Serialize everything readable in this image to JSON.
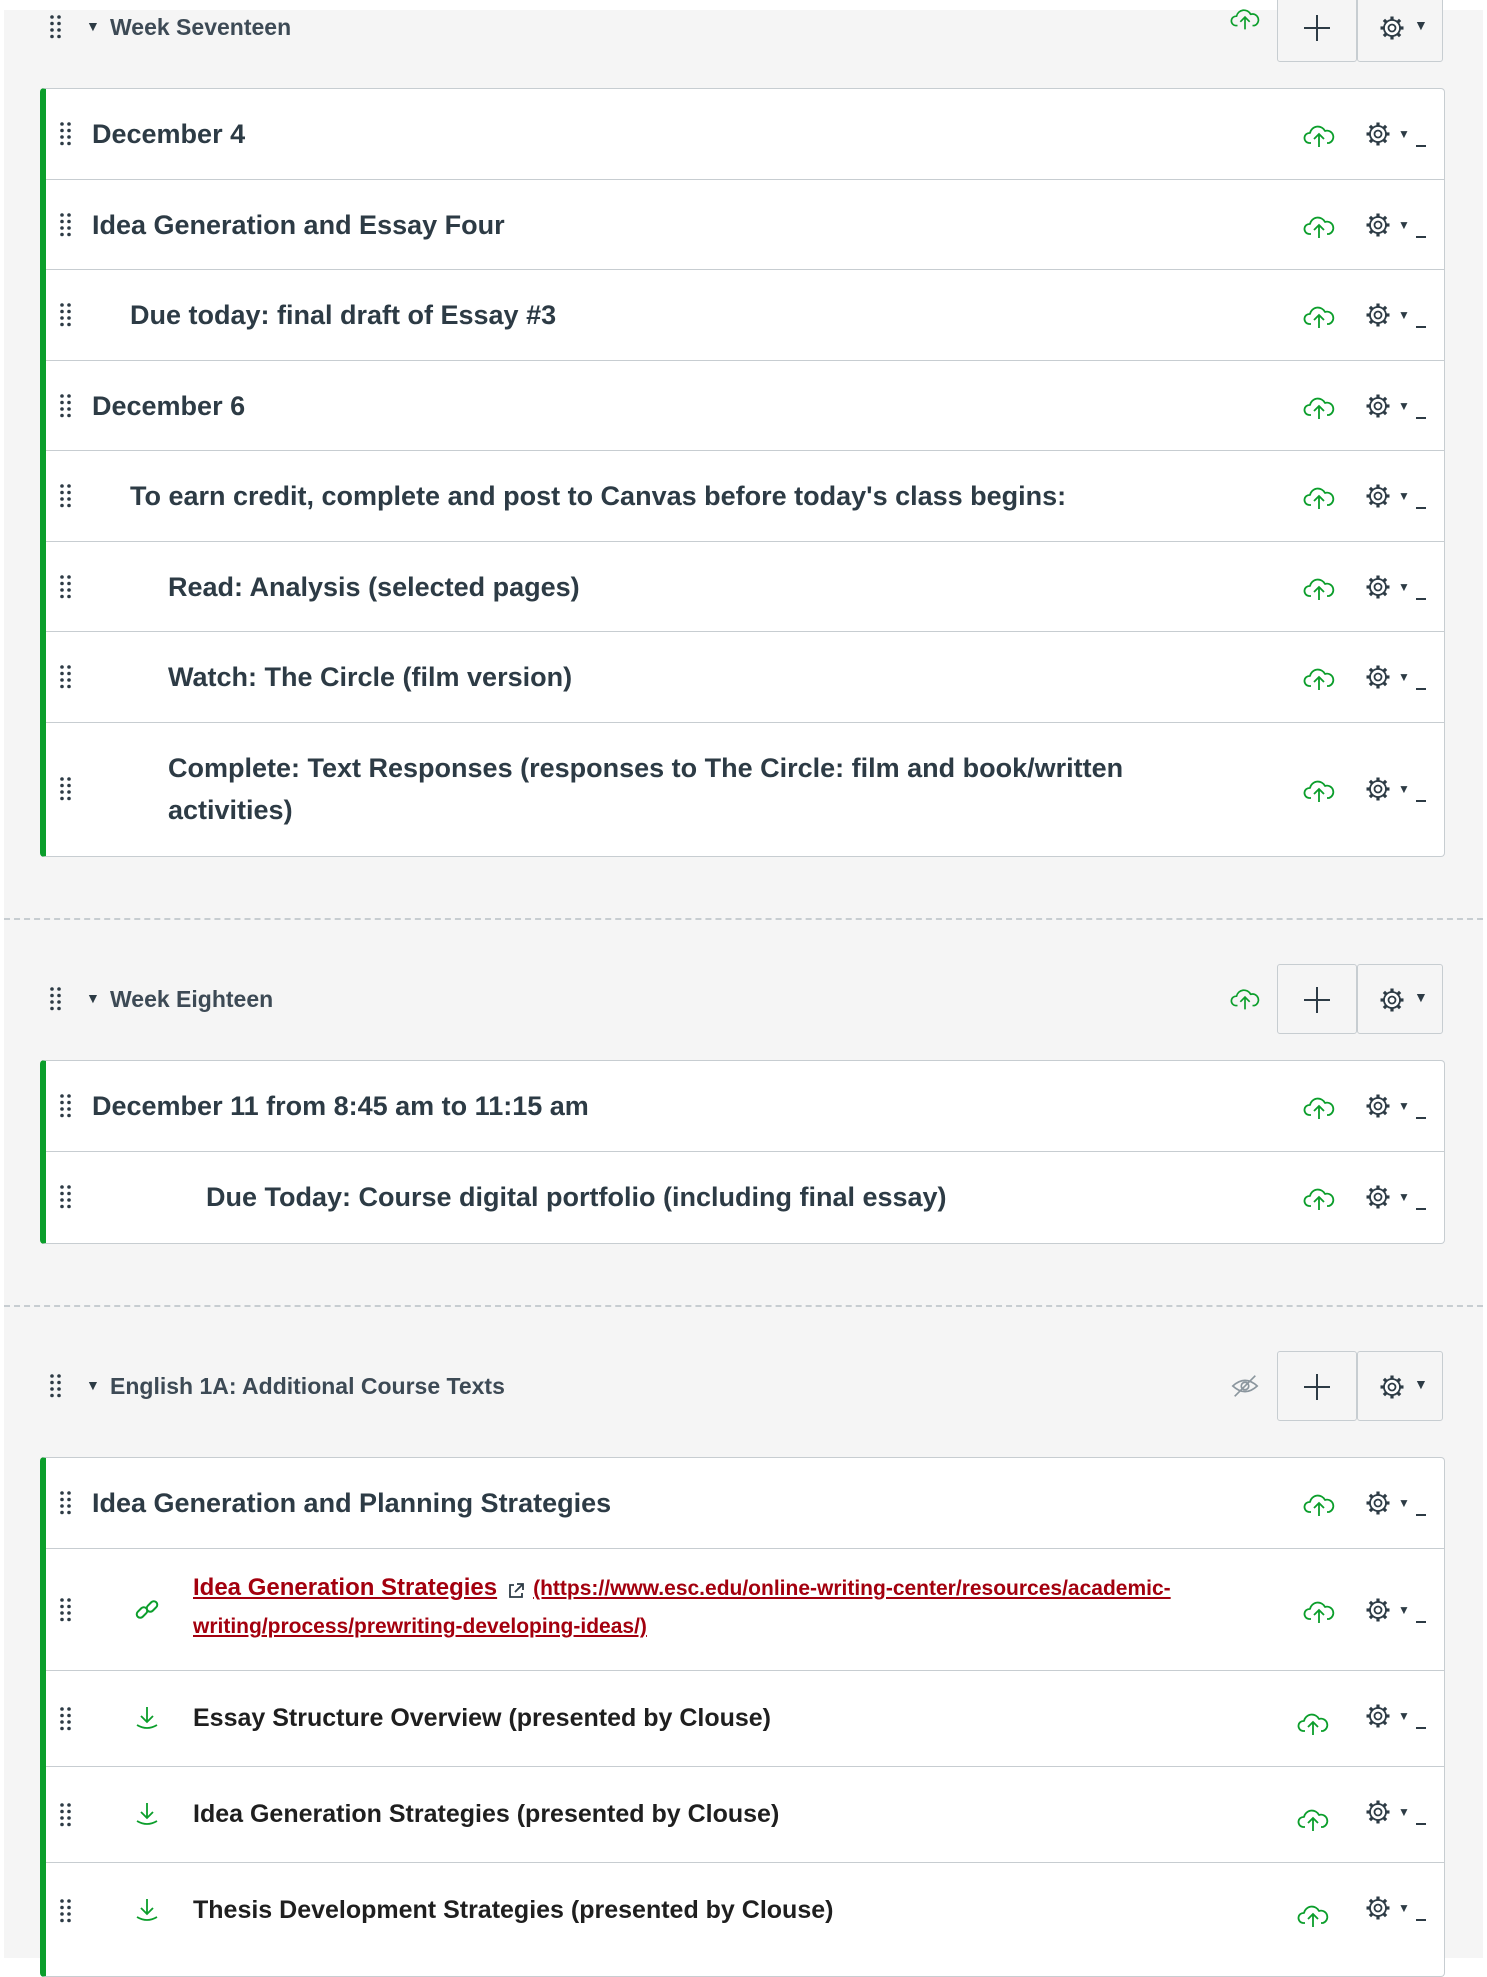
{
  "colors": {
    "published": "#0b9e2b",
    "link": "#a3000e",
    "text": "#2d3b45",
    "border": "#c7cdd1"
  },
  "icons": {
    "drag": "drag-handle-icon",
    "caret": "caret-down-icon",
    "published": "cloud-upload-icon",
    "unpublished": "eye-off-icon",
    "add": "plus-icon",
    "settings": "gear-icon",
    "external_link": "external-link-icon",
    "link_type": "link-icon",
    "file_type": "download-icon"
  },
  "caret_glyph": "▼",
  "modules": [
    {
      "title": "Week Seventeen",
      "published": true,
      "items": [
        {
          "title": "December 4",
          "indent": 0
        },
        {
          "title": "Idea Generation and Essay Four",
          "indent": 0
        },
        {
          "title": "Due today: final draft of Essay #3",
          "indent": 1
        },
        {
          "title": "December 6",
          "indent": 0
        },
        {
          "title": "To earn credit, complete and post to Canvas before today's class begins:",
          "indent": 1
        },
        {
          "title": "Read: Analysis (selected pages)",
          "indent": 2
        },
        {
          "title": "Watch: The Circle (film version)",
          "indent": 2
        },
        {
          "title": "Complete: Text Responses (responses to The Circle: film and book/written activities)",
          "indent": 2
        }
      ]
    },
    {
      "title": "Week Eighteen",
      "published": true,
      "items": [
        {
          "title": "December 11 from 8:45 am to 11:15 am",
          "indent": 0
        },
        {
          "title": "Due Today: Course digital portfolio (including final essay)",
          "indent": 3
        }
      ]
    },
    {
      "title": "English 1A: Additional Course Texts",
      "published": false,
      "items": [
        {
          "title": "Idea Generation and Planning Strategies",
          "indent": 0
        },
        {
          "title": "Idea Generation Strategies",
          "url_text": "(https://www.esc.edu/online-writing-center/resources/academic-writing/process/prewriting-developing-ideas/)",
          "type": "link"
        },
        {
          "title": "Essay Structure Overview (presented by Clouse)",
          "type": "file"
        },
        {
          "title": "Idea Generation Strategies (presented by Clouse)",
          "type": "file"
        },
        {
          "title": "Thesis Development Strategies (presented by Clouse)",
          "type": "file"
        }
      ]
    }
  ]
}
